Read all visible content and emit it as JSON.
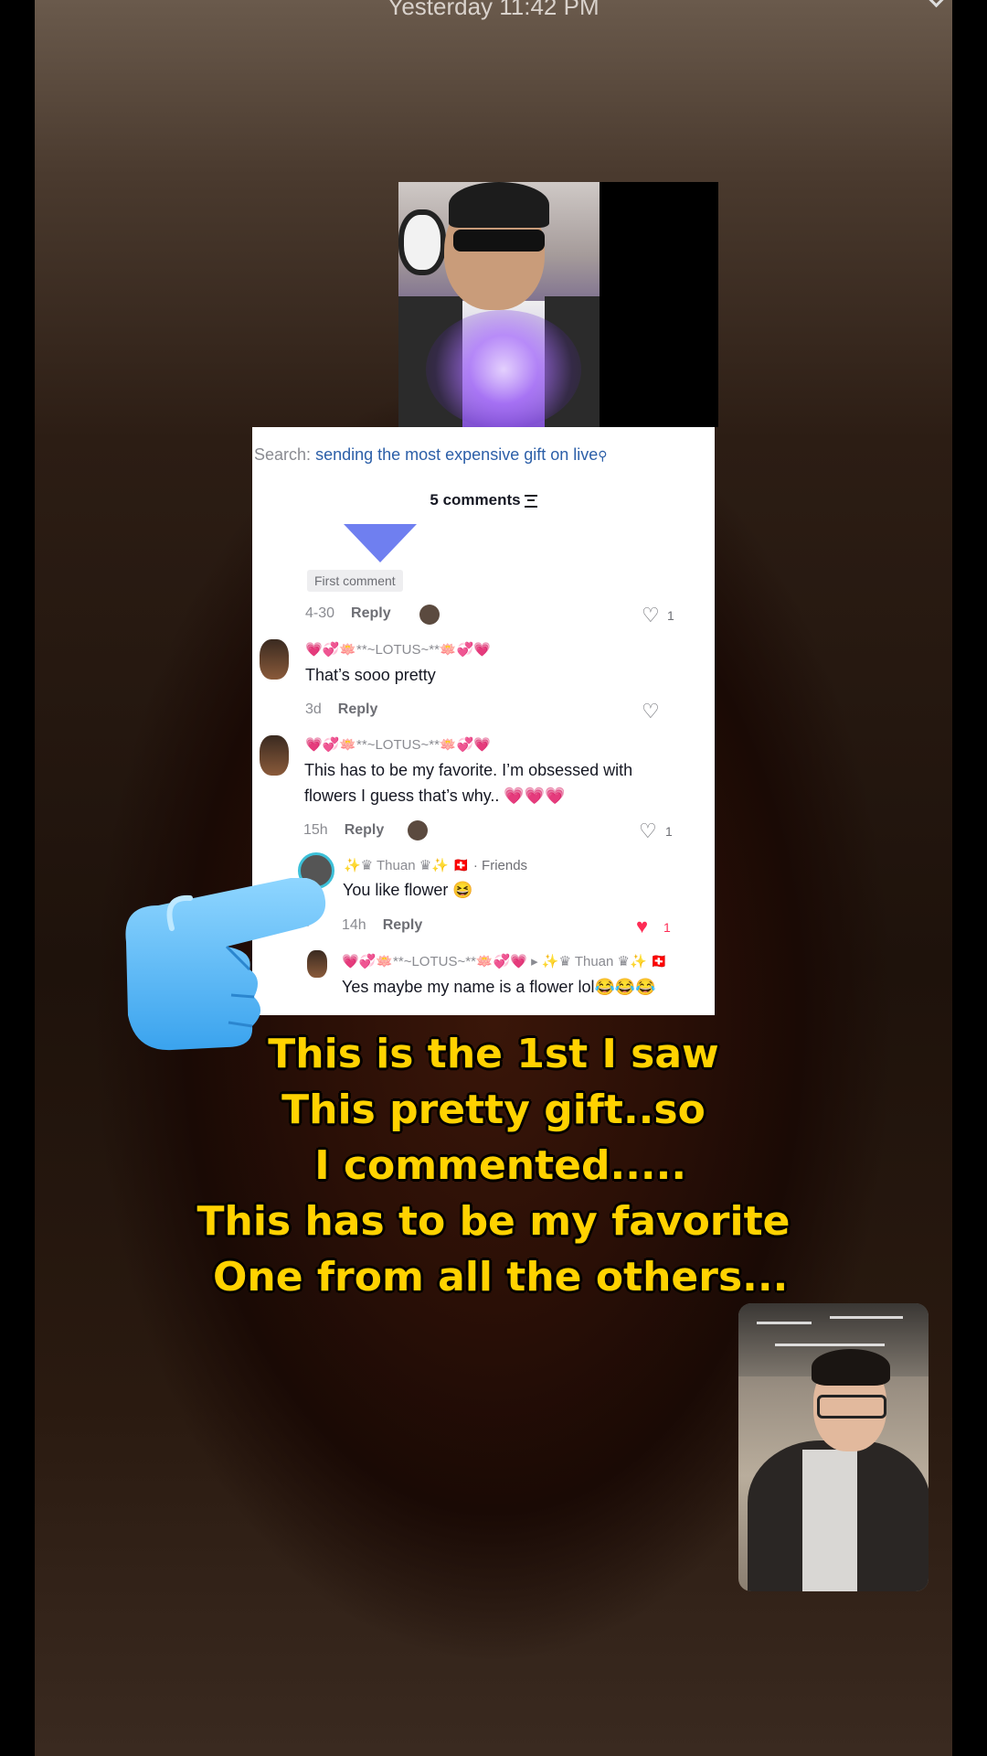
{
  "status": {
    "timestamp": "Yesterday 11:42 PM"
  },
  "search": {
    "label": "Search:",
    "query": "sending the most expensive gift on live"
  },
  "comments_header": {
    "count_label": "5 comments"
  },
  "first_badge": "First comment",
  "thread": [
    {
      "time": "4-30",
      "reply": "Reply",
      "likes": "1"
    },
    {
      "user": "💗💞🪷**~LOTUS~**🪷💞💗",
      "text": "That’s sooo pretty",
      "time": "3d",
      "reply": "Reply",
      "likes": ""
    },
    {
      "user": "💗💞🪷**~LOTUS~**🪷💞💗",
      "text_line1": "This has to be my favorite. I’m obsessed with",
      "text_line2": "flowers I guess that’s why.. 💗💗💗",
      "time": "15h",
      "reply": "Reply",
      "likes": "1"
    }
  ],
  "replies": [
    {
      "user": "✨♛ Thuan ♛✨ 🇨🇭",
      "tag": "· Friends",
      "text": "You like flower 😆",
      "time": "14h",
      "reply": "Reply",
      "likes": "1"
    },
    {
      "user": "💗💞🪷**~LOTUS~**🪷💞💗 ▸ ✨♛ Thuan ♛✨ 🇨🇭",
      "text": "Yes maybe my name is a flower lol😂😂😂"
    }
  ],
  "caption": [
    "This is the 1st I saw",
    "This pretty gift..so",
    " I commented.....",
    "This has to be my favorite",
    " One from all the others..."
  ],
  "colors": {
    "caption": "#ffd200",
    "like_red": "#fe2c55",
    "link_blue": "#2c5fa8"
  }
}
